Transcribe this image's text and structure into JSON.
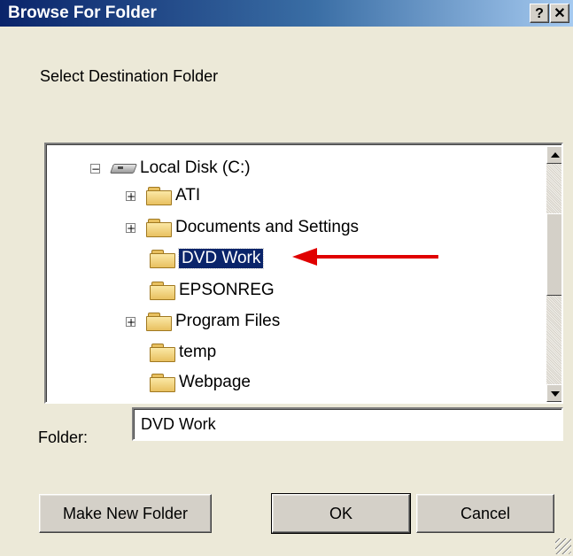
{
  "window": {
    "title": "Browse For Folder",
    "help_button": "?",
    "close_button": "✕"
  },
  "prompt": "Select Destination Folder",
  "tree": {
    "root": {
      "label": "Local Disk (C:)",
      "expander": "−",
      "icon": "hard-disk-icon"
    },
    "items": [
      {
        "label": "ATI",
        "expander": "+",
        "icon": "folder-icon",
        "selected": false
      },
      {
        "label": "Documents and Settings",
        "expander": "+",
        "icon": "folder-icon",
        "selected": false
      },
      {
        "label": "DVD Work",
        "expander": "",
        "icon": "folder-icon",
        "selected": true
      },
      {
        "label": "EPSONREG",
        "expander": "",
        "icon": "folder-icon",
        "selected": false
      },
      {
        "label": "Program Files",
        "expander": "+",
        "icon": "folder-icon",
        "selected": false
      },
      {
        "label": "temp",
        "expander": "",
        "icon": "folder-icon",
        "selected": false
      },
      {
        "label": "Webpage",
        "expander": "",
        "icon": "folder-icon",
        "selected": false
      }
    ]
  },
  "folder_field": {
    "label": "Folder:",
    "value": "DVD Work"
  },
  "buttons": {
    "make_new_folder": "Make New Folder",
    "ok": "OK",
    "cancel": "Cancel"
  },
  "colors": {
    "title_gradient_start": "#0a246a",
    "selection": "#0a246a",
    "annotation_arrow": "#e00000",
    "face": "#d4d0c8"
  }
}
